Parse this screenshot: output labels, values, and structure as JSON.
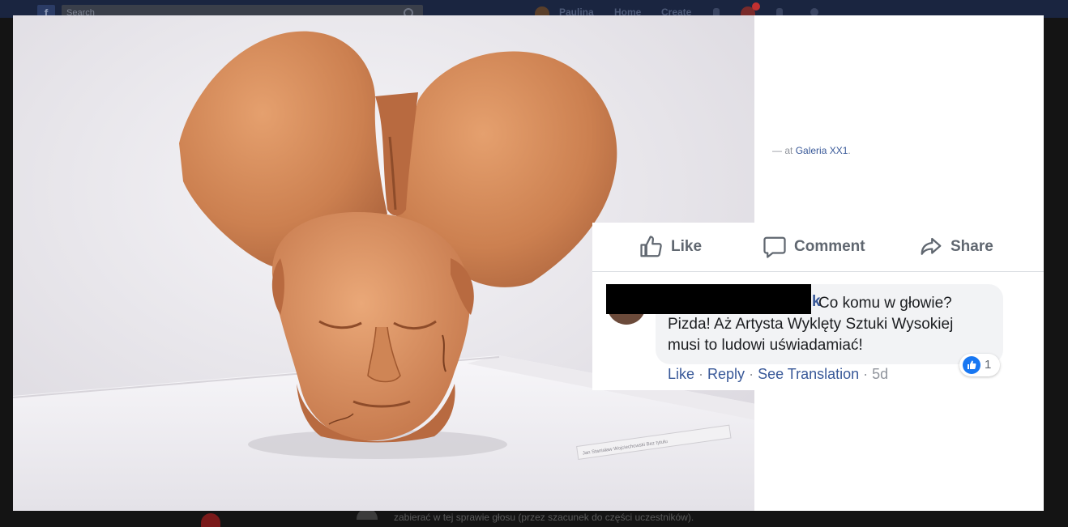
{
  "background": {
    "header": {
      "logo": "f",
      "search_placeholder": "Search",
      "nav_user": "Paulina",
      "nav_home": "Home",
      "nav_create": "Create"
    },
    "footer_snippet": "zabierać w tej sprawie głosu (przez szacunek do części uczestników)."
  },
  "photo": {
    "description_icon": "terracotta-sculpture-photo",
    "plaque_text": "Jan Stanisław Wojciechowski   Bez tytułu"
  },
  "side_panel": {
    "tag_prefix": "— at ",
    "tag_place": "Galeria XX1",
    "tag_suffix": "."
  },
  "actions": {
    "like_label": "Like",
    "comment_label": "Comment",
    "share_label": "Share"
  },
  "comment": {
    "name_tail": "k",
    "line1": "Co komu w głowie?",
    "line2": "Pizda! Aż Artysta Wyklęty Sztuki Wysokiej",
    "line3": "musi to ludowi uświadamiać!",
    "reaction_count": "1",
    "reaction_icon": "thumbs-up-icon",
    "meta": {
      "like": "Like",
      "reply": "Reply",
      "see_translation": "See Translation",
      "age": "5d",
      "separator": "·"
    }
  },
  "colors": {
    "link": "#385898",
    "action_text": "#606770",
    "bubble": "#f2f3f5",
    "reaction": "#1877f2"
  }
}
